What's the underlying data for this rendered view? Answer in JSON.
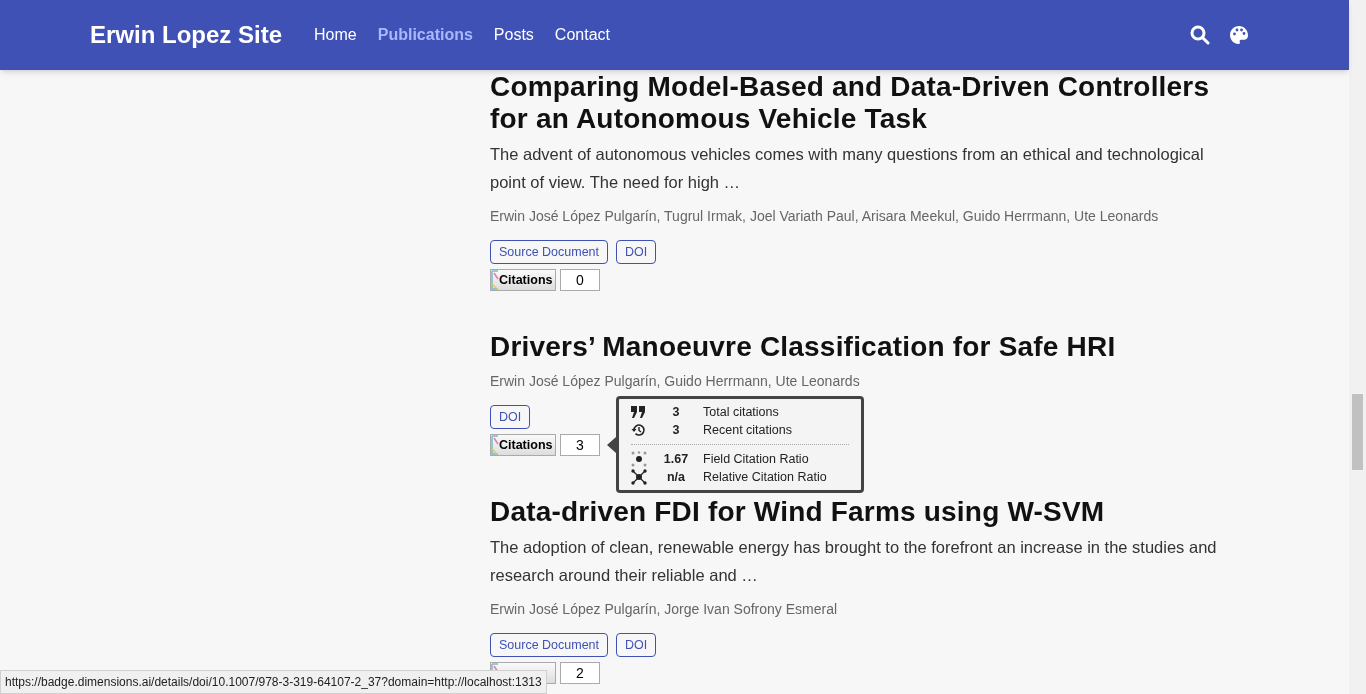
{
  "header": {
    "site_title": "Erwin Lopez Site",
    "nav": [
      {
        "label": "Home",
        "selected": false
      },
      {
        "label": "Publications",
        "selected": true
      },
      {
        "label": "Posts",
        "selected": false
      },
      {
        "label": "Contact",
        "selected": false
      }
    ]
  },
  "publications": [
    {
      "title": "Comparing Model-Based and Data-Driven Controllers for an Autonomous Vehicle Task",
      "abstract": "The advent of autonomous vehicles comes with many questions from an ethical and technological point of view. The need for high …",
      "authors": "Erwin José López Pulgarín, Tugrul Irmak, Joel Variath Paul, Arisara Meekul, Guido Herrmann, Ute Leonards",
      "links": [
        "Source Document",
        "DOI"
      ],
      "citations": {
        "label": "Citations",
        "count": "0"
      }
    },
    {
      "title": "Drivers’ Manoeuvre Classification for Safe HRI",
      "authors": "Erwin José López Pulgarín, Guido Herrmann, Ute Leonards",
      "links": [
        "DOI"
      ],
      "citations": {
        "label": "Citations",
        "count": "3",
        "tooltip": [
          {
            "kind": "quote",
            "value": "3",
            "label": "Total citations"
          },
          {
            "kind": "recent",
            "value": "3",
            "label": "Recent citations"
          },
          {
            "kind": "divider"
          },
          {
            "kind": "field",
            "value": "1.67",
            "label": "Field Citation Ratio"
          },
          {
            "kind": "relative",
            "value": "n/a",
            "label": "Relative Citation Ratio"
          }
        ]
      }
    },
    {
      "title": "Data-driven FDI for Wind Farms using W-SVM",
      "abstract": "The adoption of clean, renewable energy has brought to the forefront an increase in the studies and research around their reliable and …",
      "authors": "Erwin José López Pulgarín, Jorge Ivan Sofrony Esmeral",
      "links": [
        "Source Document",
        "DOI"
      ],
      "citations": {
        "count": "2"
      }
    }
  ],
  "status_bar": "https://badge.dimensions.ai/details/doi/10.1007/978-3-319-64107-2_37?domain=http://localhost:1313"
}
